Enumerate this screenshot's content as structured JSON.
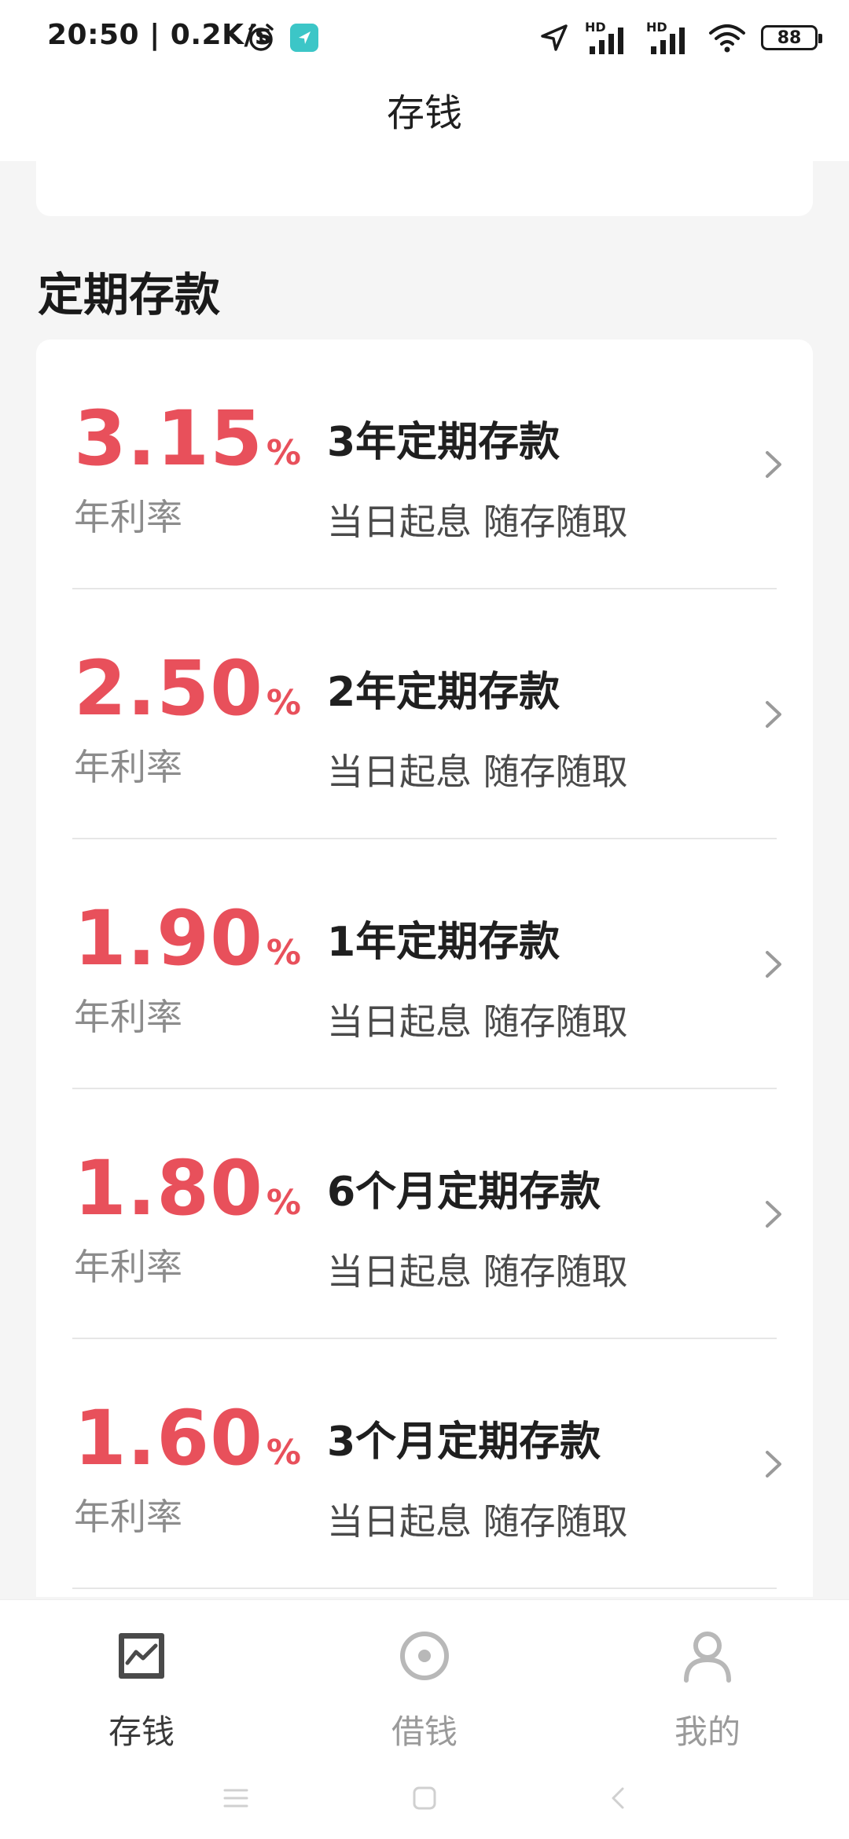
{
  "status_bar": {
    "time_speed": "20:50 | 0.2K/s",
    "signal_label_1": "HD",
    "signal_label_2": "HD",
    "battery": "88"
  },
  "app_bar": {
    "title": "存钱"
  },
  "section": {
    "title": "定期存款"
  },
  "products": [
    {
      "rate": "3.15",
      "percent": "%",
      "rate_label": "年利率",
      "name": "3年定期存款",
      "desc": "当日起息 随存随取"
    },
    {
      "rate": "2.50",
      "percent": "%",
      "rate_label": "年利率",
      "name": "2年定期存款",
      "desc": "当日起息 随存随取"
    },
    {
      "rate": "1.90",
      "percent": "%",
      "rate_label": "年利率",
      "name": "1年定期存款",
      "desc": "当日起息 随存随取"
    },
    {
      "rate": "1.80",
      "percent": "%",
      "rate_label": "年利率",
      "name": "6个月定期存款",
      "desc": "当日起息 随存随取"
    },
    {
      "rate": "1.60",
      "percent": "%",
      "rate_label": "年利率",
      "name": "3个月定期存款",
      "desc": "当日起息 随存随取"
    }
  ],
  "tab_bar": {
    "tabs": [
      {
        "label": "存钱",
        "icon": "deposit-chart-icon"
      },
      {
        "label": "借钱",
        "icon": "loan-circle-icon"
      },
      {
        "label": "我的",
        "icon": "profile-icon"
      }
    ]
  },
  "colors": {
    "accent_rate": "#e8505b",
    "text_primary": "#1f1f1f",
    "text_secondary": "#8c8c8c",
    "background": "#f5f5f5"
  }
}
